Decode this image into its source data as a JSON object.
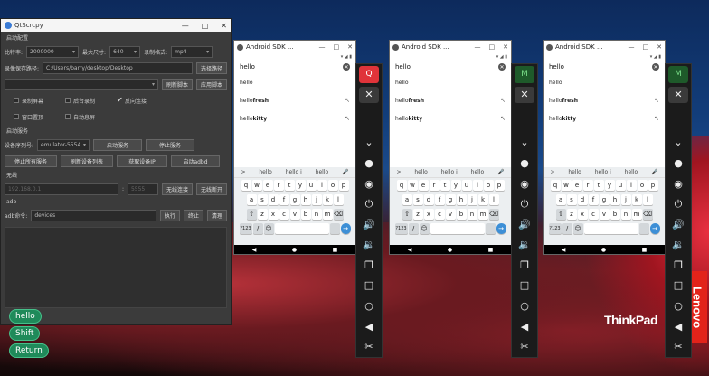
{
  "app": {
    "title": "QtScrcpy",
    "controls": {
      "min": "—",
      "max": "□",
      "close": "✕"
    },
    "group_start": "启动配置",
    "bitrate_label": "比特率:",
    "bitrate_value": "2000000",
    "maxsize_label": "最大尺寸:",
    "maxsize_value": "640",
    "record_label": "录制格式:",
    "record_value": "mp4",
    "savepath_label": "录像保存路径:",
    "savepath_value": "C:/Users/barry/desktop/Desktop",
    "select_path": "选择路径",
    "refresh_script": "刷新脚本",
    "apply_script": "应用脚本",
    "opt_record": "录制屏幕",
    "opt_bg_record": "后台录制",
    "opt_reverse": "反向连接",
    "opt_window_top": "窗口置顶",
    "opt_auto_off": "自动息屏",
    "group_start_stop": "启动服务",
    "device_serial_label": "设备序列号:",
    "device_serial_value": "emulator-5554",
    "start_service": "启动服务",
    "stop_service": "停止服务",
    "stop_all": "停止所有服务",
    "refresh_devices": "刷新设备列表",
    "get_ip": "获取设备IP",
    "start_adbd": "启动adbd",
    "group_wireless": "无线",
    "ip_value": "192.168.0.1",
    "port_value": "5555",
    "wireless_connect": "无线连接",
    "wireless_disconnect": "无线断开",
    "group_adb": "adb",
    "adb_cmd_label": "adb命令:",
    "adb_cmd_value": "devices",
    "adb_exec": "执行",
    "adb_stop": "终止",
    "adb_clear": "清理"
  },
  "overlay_buttons": [
    "hello",
    "Shift",
    "Return"
  ],
  "phone": {
    "title": "Android SDK ...",
    "controls": {
      "min": "—",
      "max": "□",
      "close": "✕"
    },
    "status_icons": "▾ ◢ ▮",
    "query": "hello",
    "clear": "✕",
    "suggestions": [
      {
        "pre": "hello",
        "bold": ""
      },
      {
        "pre": "hello ",
        "bold": "fresh"
      },
      {
        "pre": "hello ",
        "bold": "kitty"
      }
    ],
    "arrow": "↖",
    "kb_suggest": [
      ">",
      "hello",
      "hello i",
      "hello",
      "🎤"
    ],
    "row1": [
      "q",
      "w",
      "e",
      "r",
      "t",
      "y",
      "u",
      "i",
      "o",
      "p"
    ],
    "row2": [
      "a",
      "s",
      "d",
      "f",
      "g",
      "h",
      "j",
      "k",
      "l"
    ],
    "row3": [
      "⇧",
      "z",
      "x",
      "c",
      "v",
      "b",
      "n",
      "m",
      "⌫"
    ],
    "row4_left": "?123",
    "row4_slash": "/",
    "row4_emoji": "☺",
    "row4_dot": ".",
    "enter": "→",
    "nav": [
      "◀",
      "●",
      "■"
    ]
  },
  "toolbar": {
    "items": [
      "✕",
      "⌄",
      "●",
      "◉",
      "⏻",
      "🔊",
      "🔉",
      "❐",
      "□",
      "○",
      "◀",
      "✂"
    ],
    "logo_red": "Q",
    "logo_green": "M"
  },
  "brand": {
    "thinkpad": "ThinkPad",
    "lenovo": "Lenovo"
  }
}
